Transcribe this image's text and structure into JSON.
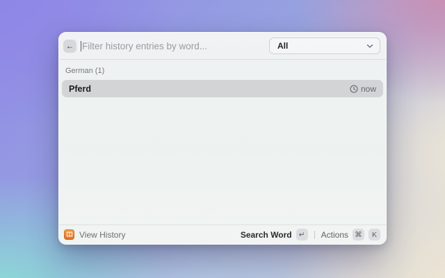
{
  "background": {
    "corner_colors": {
      "top_left": "#8f87e6",
      "top_right": "#c98fb4",
      "bottom_left": "#8bdcd6",
      "bottom_right": "#ece5d4",
      "bottom_middle": "#b2cde6"
    }
  },
  "window": {
    "topbar": {
      "back_icon_glyph": "←",
      "search": {
        "value": "",
        "placeholder": "Filter history entries by word..."
      },
      "dropdown": {
        "value": "All"
      }
    },
    "list": {
      "section_label": "German (1)",
      "items": [
        {
          "title": "Pferd",
          "meta_icon": "clock-icon",
          "meta_text": "now"
        }
      ]
    },
    "statusbar": {
      "app_icon": "open-book-icon",
      "app_icon_color": "#e8813a",
      "app_label": "View History",
      "primary_action": {
        "label": "Search Word",
        "key": "↵"
      },
      "separator": "|",
      "secondary_action": {
        "label": "Actions",
        "keys": [
          "⌘",
          "K"
        ]
      }
    }
  }
}
